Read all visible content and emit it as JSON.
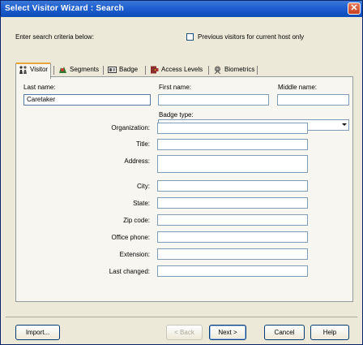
{
  "window": {
    "title": "Select Visitor Wizard : Search"
  },
  "header": {
    "instructions": "Enter search criteria below:",
    "checkbox_label": "Previous visitors for current host only"
  },
  "tabs": [
    {
      "label": "Visitor"
    },
    {
      "label": "Segments"
    },
    {
      "label": "Badge"
    },
    {
      "label": "Access Levels"
    },
    {
      "label": "Biometrics"
    }
  ],
  "visitor": {
    "last_name_label": "Last name:",
    "last_name_value": "Caretaker",
    "first_name_label": "First name:",
    "first_name_value": "",
    "middle_name_label": "Middle name:",
    "middle_name_value": "",
    "badge_type_label": "Badge type:",
    "badge_type_value": "",
    "fields": [
      {
        "label": "Organization:"
      },
      {
        "label": "Title:"
      },
      {
        "label": "Address:"
      },
      {
        "label": "City:"
      },
      {
        "label": "State:"
      },
      {
        "label": "Zip code:"
      },
      {
        "label": "Office phone:"
      },
      {
        "label": "Extension:"
      },
      {
        "label": "Last changed:"
      }
    ]
  },
  "buttons": {
    "import": "Import...",
    "back": "< Back",
    "next": "Next >",
    "cancel": "Cancel",
    "help": "Help"
  }
}
